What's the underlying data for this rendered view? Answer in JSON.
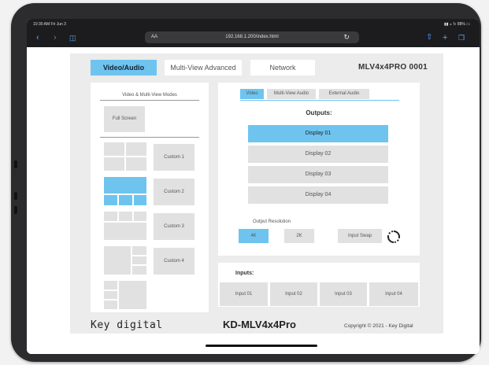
{
  "status": {
    "time": "10:30 AM  Fri Jun 3",
    "right": "▮▮ ◒ ↻ 88% ▭"
  },
  "browser": {
    "url": "192.168.1.200/index.html",
    "aa": "AA",
    "back_icon": "chevron-left-icon",
    "forward_icon": "chevron-right-icon",
    "reload_icon": "reload-icon"
  },
  "tabs": [
    {
      "label": "Video/Audio",
      "active": true
    },
    {
      "label": "Multi-View Advanced",
      "active": false
    },
    {
      "label": "Network",
      "active": false
    }
  ],
  "model": "MLV4x4PRO  0001",
  "modes": {
    "title": "Video & Multi-View Modes",
    "full_screen": "Full Screen",
    "custom": [
      "Custom 1",
      "Custom 2",
      "Custom 3",
      "Custom 4"
    ]
  },
  "subtabs": [
    {
      "label": "Video",
      "active": true
    },
    {
      "label": "Multi-View Audio",
      "active": false
    },
    {
      "label": "External Audio",
      "active": false
    }
  ],
  "outputs": {
    "title": "Outputs:",
    "items": [
      {
        "label": "Display 01",
        "active": true
      },
      {
        "label": "Display 02",
        "active": false
      },
      {
        "label": "Display 03",
        "active": false
      },
      {
        "label": "Display 04",
        "active": false
      }
    ]
  },
  "resolution": {
    "title": "Output Resolution",
    "options": [
      {
        "label": "4K",
        "active": true
      },
      {
        "label": "2K",
        "active": false
      }
    ],
    "swap": "Input Swap"
  },
  "inputs": {
    "title": "Inputs:",
    "items": [
      "Input 01",
      "Input 02",
      "Input 03",
      "Input 04"
    ]
  },
  "footer": {
    "brand": "Key digital",
    "product": "KD-MLV4x4Pro",
    "copyright": "Copyright © 2021 - Key Digital"
  },
  "colors": {
    "accent": "#6fc4ef",
    "panel": "#ececec",
    "tile": "#e1e1e1"
  }
}
